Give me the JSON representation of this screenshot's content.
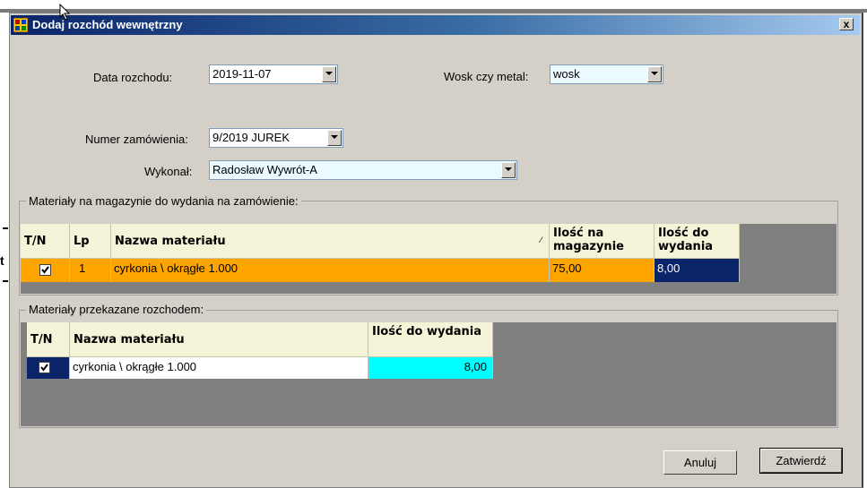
{
  "window": {
    "title": "Dodaj rozchód wewnętrzny",
    "close_label": "x"
  },
  "form": {
    "date_label": "Data rozchodu:",
    "date_value": "2019-11-07",
    "wax_metal_label": "Wosk czy metal:",
    "wax_metal_value": "wosk",
    "order_label": "Numer zamówienia:",
    "order_value": "9/2019 JUREK",
    "performer_label": "Wykonał:",
    "performer_value": "Radosław Wywrót-A"
  },
  "stock_group": {
    "label": "Materiały na magazynie do wydania na zamówienie:",
    "columns": {
      "tn": "T/N",
      "lp": "Lp",
      "name": "Nazwa materiału",
      "stock_qty": "Ilość na magazynie",
      "issue_qty": "Ilość do wydania"
    },
    "rows": [
      {
        "checked": true,
        "lp": "1",
        "name": "cyrkonia \\ okrągłe 1.000",
        "stock_qty": "75,00",
        "issue_qty": "8,00"
      }
    ]
  },
  "issued_group": {
    "label": "Materiały przekazane rozchodem:",
    "columns": {
      "tn": "T/N",
      "name": "Nazwa materiału",
      "issue_qty": "Ilość do wydania"
    },
    "rows": [
      {
        "checked": true,
        "name": "cyrkonia \\ okrągłe 1.000",
        "issue_qty": "8,00"
      }
    ]
  },
  "buttons": {
    "cancel": "Anuluj",
    "confirm": "Zatwierdź"
  },
  "background": {
    "fragment_letter": "t"
  },
  "colors": {
    "selected_row": "#ffa500",
    "selected_cell": "#0a246a",
    "qty_cell": "#00ffff",
    "header_bg": "#f5f3d8"
  }
}
